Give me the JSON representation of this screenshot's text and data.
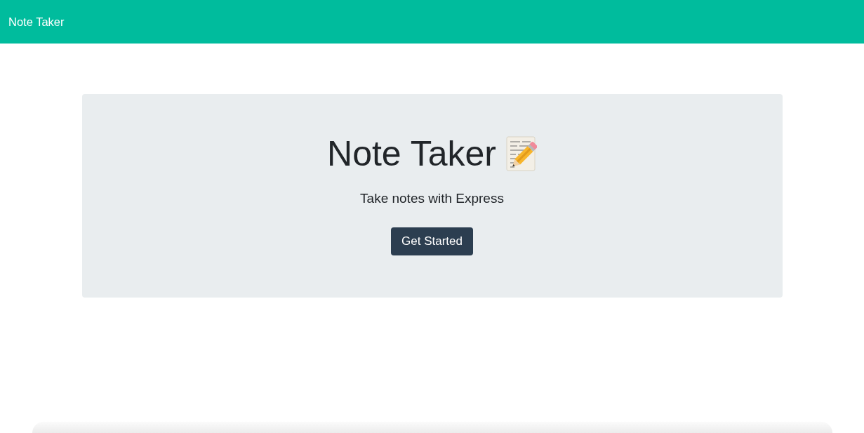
{
  "navbar": {
    "brand": "Note Taker"
  },
  "hero": {
    "title": "Note Taker",
    "subtitle": "Take notes with Express",
    "button": "Get Started"
  }
}
